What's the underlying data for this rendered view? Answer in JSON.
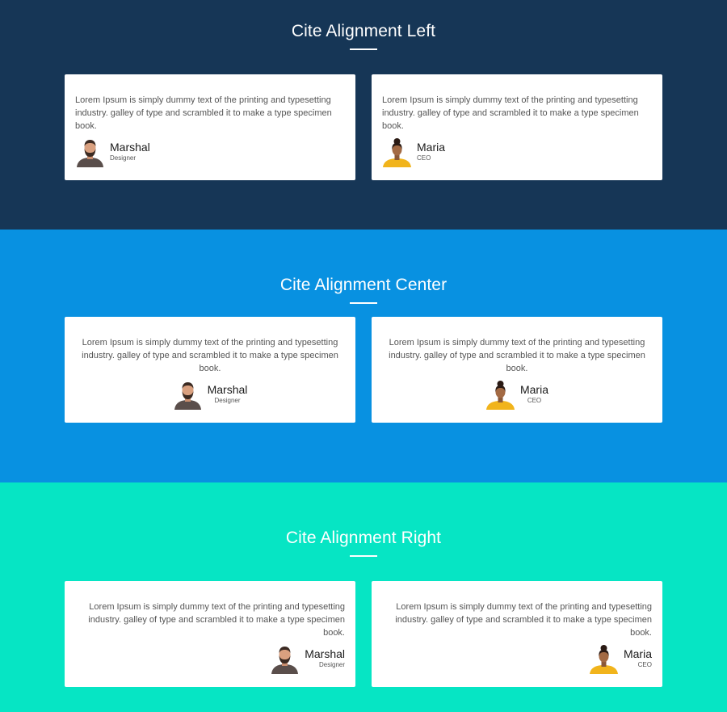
{
  "sections": [
    {
      "title": "Cite Alignment Left",
      "align": "left",
      "cards": [
        {
          "quote": "Lorem Ipsum is simply dummy text of the printing and typesetting industry. galley of type and scrambled it to make a type specimen book.",
          "name": "Marshal",
          "role": "Designer"
        },
        {
          "quote": "Lorem Ipsum is simply dummy text of the printing and typesetting industry. galley of type and scrambled it to make a type specimen book.",
          "name": "Maria",
          "role": "CEO"
        }
      ]
    },
    {
      "title": "Cite Alignment Center",
      "align": "center",
      "cards": [
        {
          "quote": "Lorem Ipsum is simply dummy text of the printing and typesetting industry. galley of type and scrambled it to make a type specimen book.",
          "name": "Marshal",
          "role": "Designer"
        },
        {
          "quote": "Lorem Ipsum is simply dummy text of the printing and typesetting industry. galley of type and scrambled it to make a type specimen book.",
          "name": "Maria",
          "role": "CEO"
        }
      ]
    },
    {
      "title": "Cite Alignment Right",
      "align": "right",
      "cards": [
        {
          "quote": "Lorem Ipsum is simply dummy text of the printing and typesetting industry. galley of type and scrambled it to make a type specimen book.",
          "name": "Marshal",
          "role": "Designer"
        },
        {
          "quote": "Lorem Ipsum is simply dummy text of the printing and typesetting industry. galley of type and scrambled it to make a type specimen book.",
          "name": "Maria",
          "role": "CEO"
        }
      ]
    }
  ],
  "colors": {
    "section_left_bg": "#163656",
    "section_center_bg": "#0891e1",
    "section_right_bg": "#06e5c4",
    "card_bg": "#ffffff",
    "title_text": "#ffffff"
  },
  "icons": {
    "marshal_avatar": "man-avatar-photo",
    "maria_avatar": "woman-avatar-photo"
  }
}
